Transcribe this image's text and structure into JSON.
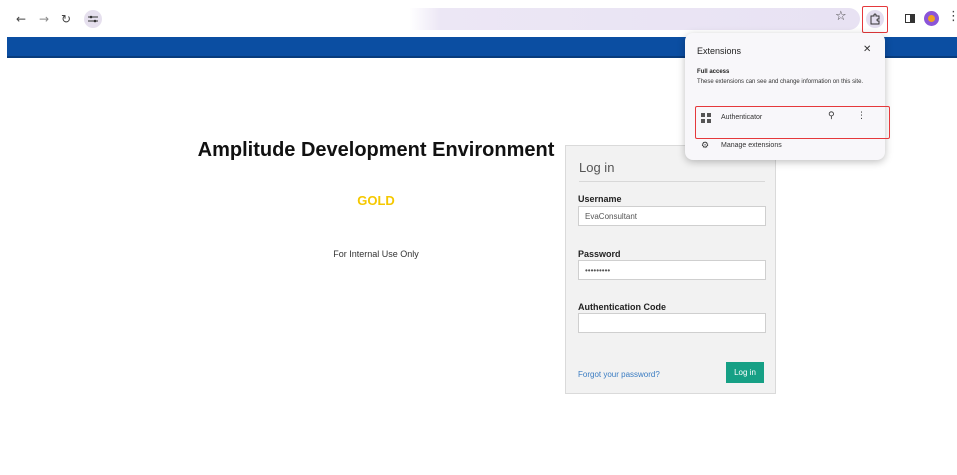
{
  "browser": {
    "icons": {
      "back": "arrow-left-icon",
      "forward": "arrow-right-icon",
      "reload": "reload-icon",
      "site_info": "tune-icon",
      "bookmark": "star-icon",
      "extensions": "puzzle-icon",
      "side_panel": "side-panel-icon",
      "profile": "profile-avatar",
      "menu": "kebab-menu-icon"
    },
    "highlight_color": "#e5383b"
  },
  "banner": {
    "color": "#0b4ea2"
  },
  "page": {
    "title": "Amplitude Development Environment",
    "tier": "GOLD",
    "tier_color": "#f5c800",
    "notice": "For Internal Use Only"
  },
  "login": {
    "heading": "Log in",
    "username_label": "Username",
    "username_value": "EvaConsultant",
    "password_label": "Password",
    "password_value": "•••••••••",
    "auth_label": "Authentication Code",
    "auth_value": "",
    "forgot_link": "Forgot your password?",
    "submit_label": "Log in",
    "submit_color": "#16a085"
  },
  "extensions_popup": {
    "title": "Extensions",
    "section": "Full access",
    "description": "These extensions can see and change information on this site.",
    "items": [
      {
        "name": "Authenticator",
        "icon": "qr-code-icon"
      }
    ],
    "manage_label": "Manage extensions"
  }
}
